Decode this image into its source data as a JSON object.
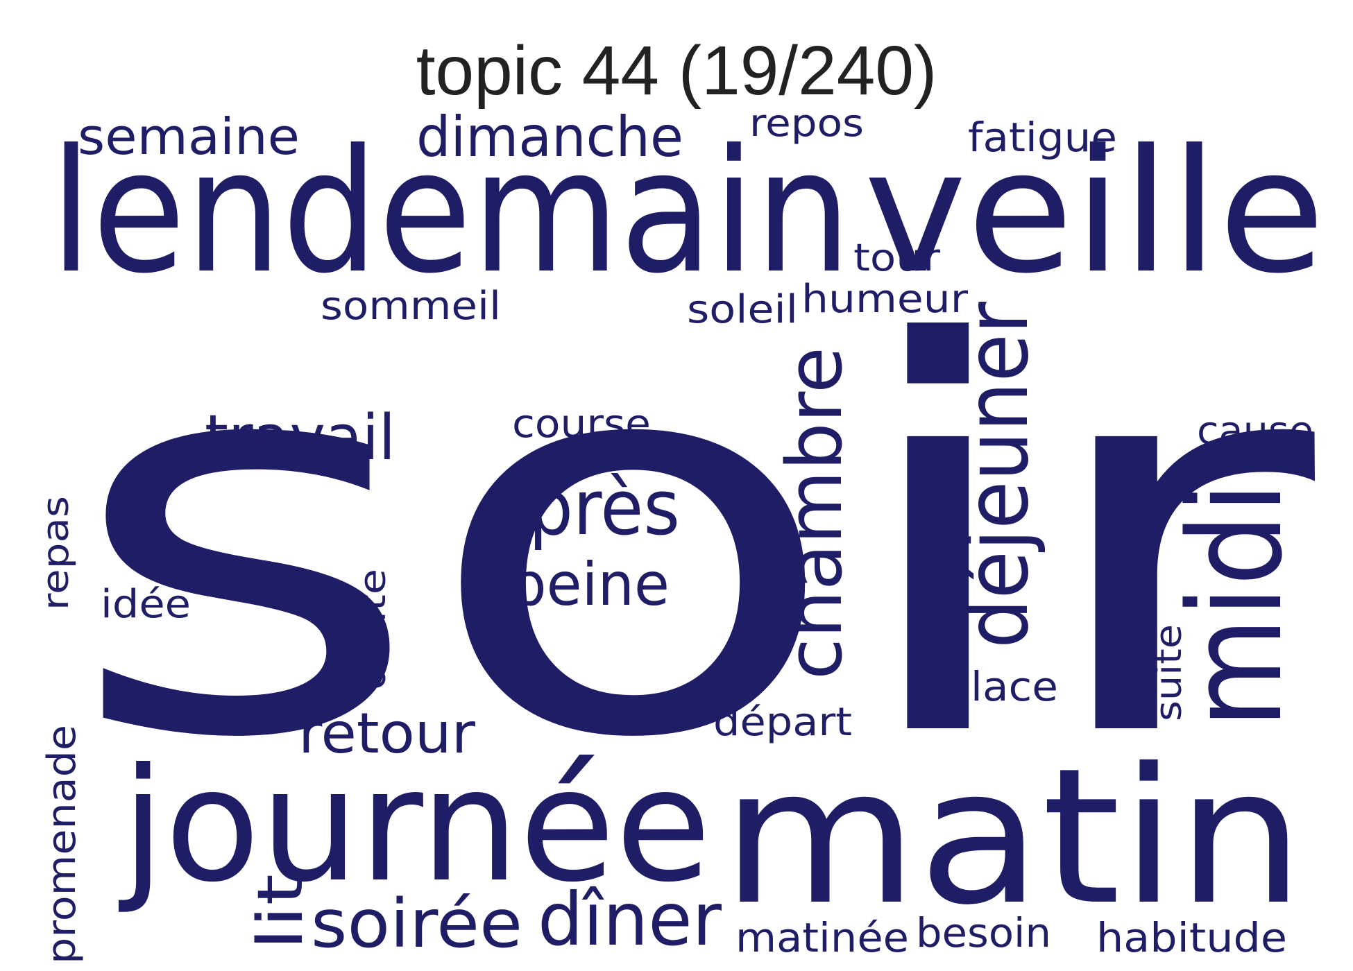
{
  "title": "topic 44 (19/240)",
  "color": "#1f1d66",
  "words": [
    {
      "text": "soir"
    },
    {
      "text": "lendemain"
    },
    {
      "text": "veille"
    },
    {
      "text": "journée"
    },
    {
      "text": "matin"
    },
    {
      "text": "midi"
    },
    {
      "text": "déjeuner"
    },
    {
      "text": "chambre"
    },
    {
      "text": "après"
    },
    {
      "text": "peine"
    },
    {
      "text": "travail"
    },
    {
      "text": "course"
    },
    {
      "text": "semaine"
    },
    {
      "text": "dimanche"
    },
    {
      "text": "repos"
    },
    {
      "text": "fatigue"
    },
    {
      "text": "tour"
    },
    {
      "text": "sommeil"
    },
    {
      "text": "soleil"
    },
    {
      "text": "humeur"
    },
    {
      "text": "cause"
    },
    {
      "text": "repas"
    },
    {
      "text": "idée"
    },
    {
      "text": "doute"
    },
    {
      "text": "retour"
    },
    {
      "text": "départ"
    },
    {
      "text": "place"
    },
    {
      "text": "suite"
    },
    {
      "text": "promenade"
    },
    {
      "text": "lit"
    },
    {
      "text": "soirée"
    },
    {
      "text": "dîner"
    },
    {
      "text": "matinée"
    },
    {
      "text": "besoin"
    },
    {
      "text": "habitude"
    }
  ]
}
